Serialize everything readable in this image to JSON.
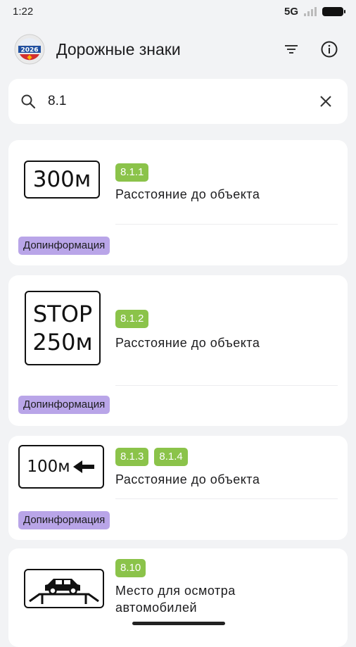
{
  "status": {
    "time": "1:22",
    "network": "5G"
  },
  "app": {
    "title": "Дорожные знаки",
    "logo_text": "2026"
  },
  "search": {
    "value": "8.1"
  },
  "cards": [
    {
      "sign_text": "300м",
      "codes": [
        "8.1.1"
      ],
      "title": "Расстояние до объекта",
      "tag": "Допинформация"
    },
    {
      "sign_line1": "STOP",
      "sign_line2": "250м",
      "codes": [
        "8.1.2"
      ],
      "title": "Расстояние до объекта",
      "tag": "Допинформация"
    },
    {
      "sign_text": "100м",
      "codes": [
        "8.1.3",
        "8.1.4"
      ],
      "title": "Расстояние до объекта",
      "tag": "Допинформация"
    },
    {
      "codes": [
        "8.10"
      ],
      "title_line1": "Место для осмотра",
      "title_line2": "автомобилей"
    }
  ],
  "colors": {
    "code_badge": "#8bc34a",
    "tag_badge": "#b9a5e8",
    "background": "#f2f3f5"
  }
}
